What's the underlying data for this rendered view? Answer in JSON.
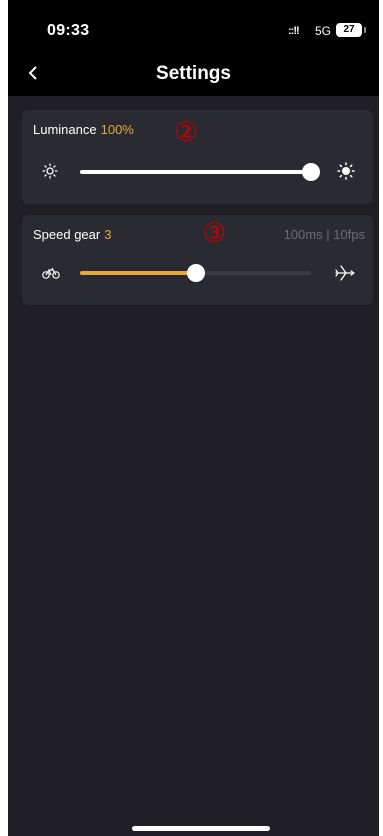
{
  "status": {
    "time": "09:33",
    "signal": "::!!",
    "network": "5G",
    "battery": "27"
  },
  "nav": {
    "back_icon": "chevron-left-icon",
    "title": "Settings"
  },
  "luminance": {
    "label": "Luminance",
    "value": "100%",
    "marker": "②",
    "level": 1.0,
    "min_icon": "sun-low-icon",
    "max_icon": "sun-high-icon"
  },
  "speed": {
    "label": "Speed gear",
    "value": "3",
    "marker": "③",
    "timing": "100ms  |  10fps",
    "level": 0.5,
    "min_icon": "bicycle-icon",
    "max_icon": "airplane-icon"
  },
  "colors": {
    "accent": "#e5a83a",
    "background": "#1f1f25",
    "card": "#2a2a32"
  }
}
